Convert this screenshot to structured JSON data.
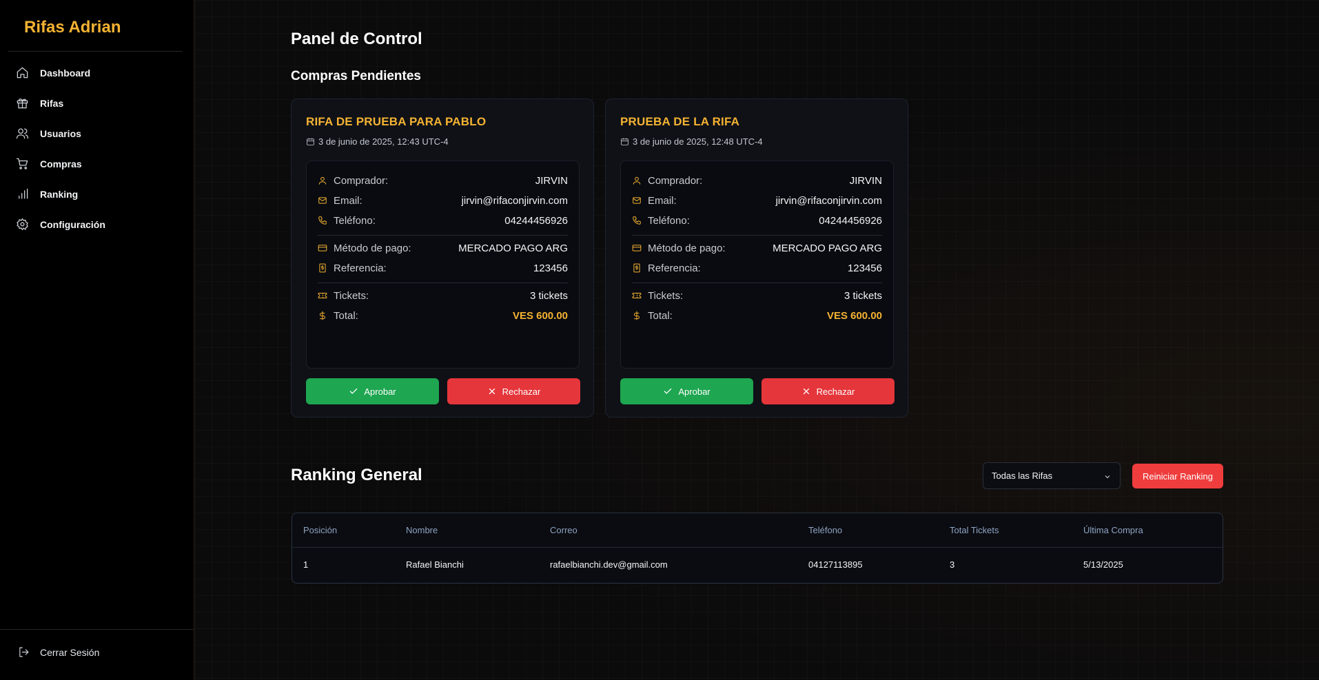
{
  "app": {
    "brand": "Rifas Adrian"
  },
  "sidebar": {
    "items": [
      {
        "label": "Dashboard",
        "icon": "home-icon"
      },
      {
        "label": "Rifas",
        "icon": "gift-icon"
      },
      {
        "label": "Usuarios",
        "icon": "users-icon"
      },
      {
        "label": "Compras",
        "icon": "cart-icon"
      },
      {
        "label": "Ranking",
        "icon": "bar-chart-icon"
      },
      {
        "label": "Configuración",
        "icon": "gear-icon"
      }
    ],
    "logout_label": "Cerrar Sesión"
  },
  "main": {
    "title": "Panel de Control",
    "pending_title": "Compras Pendientes",
    "labels": {
      "buyer": "Comprador:",
      "email": "Email:",
      "phone": "Teléfono:",
      "method": "Método de pago:",
      "reference": "Referencia:",
      "tickets": "Tickets:",
      "total": "Total:"
    },
    "purchases": [
      {
        "raffle": "RIFA DE PRUEBA PARA PABLO",
        "date": "3 de junio de 2025, 12:43 UTC-4",
        "buyer": "JIRVIN",
        "email": "jirvin@rifaconjirvin.com",
        "phone": "04244456926",
        "method": "MERCADO PAGO ARG",
        "reference": "123456",
        "tickets": "3 tickets",
        "total": "VES 600.00",
        "approve_label": "Aprobar",
        "reject_label": "Rechazar"
      },
      {
        "raffle": "PRUEBA DE LA RIFA",
        "date": "3 de junio de 2025, 12:48 UTC-4",
        "buyer": "JIRVIN",
        "email": "jirvin@rifaconjirvin.com",
        "phone": "04244456926",
        "method": "MERCADO PAGO ARG",
        "reference": "123456",
        "tickets": "3 tickets",
        "total": "VES 600.00",
        "approve_label": "Aprobar",
        "reject_label": "Rechazar"
      }
    ],
    "ranking": {
      "title": "Ranking General",
      "filter_selected": "Todas las Rifas",
      "reset_label": "Reiniciar Ranking",
      "columns": [
        "Posición",
        "Nombre",
        "Correo",
        "Teléfono",
        "Total Tickets",
        "Última Compra"
      ],
      "rows": [
        [
          "1",
          "Rafael Bianchi",
          "rafaelbianchi.dev@gmail.com",
          "04127113895",
          "3",
          "5/13/2025"
        ]
      ]
    }
  },
  "colors": {
    "accent": "#f5b332",
    "approve": "#1ea650",
    "reject": "#e5363b"
  }
}
